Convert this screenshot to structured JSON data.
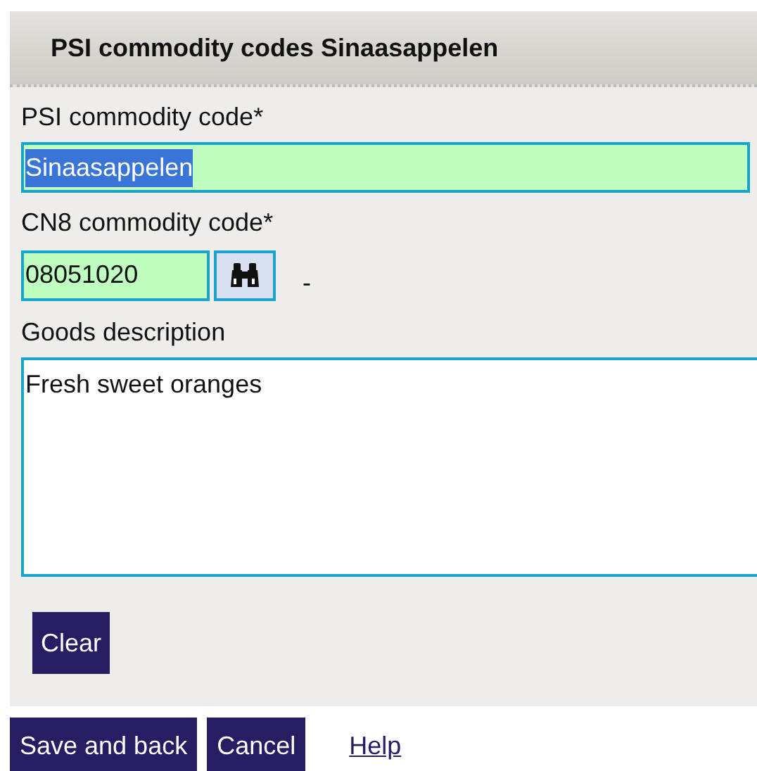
{
  "panel": {
    "title": "PSI commodity codes Sinaasappelen"
  },
  "fields": [
    {
      "kind": "text",
      "label": "PSI commodity code*",
      "value": "Sinaasappelen",
      "text_selected": true
    },
    {
      "kind": "lookup",
      "label": "CN8 commodity code*",
      "value": "08051020",
      "text_selected": false,
      "suffix": "-"
    },
    {
      "kind": "textarea",
      "label": "Goods description",
      "value": "Fresh sweet oranges",
      "text_selected": false
    }
  ],
  "panel_buttons": [
    "Clear"
  ],
  "footer": {
    "buttons": [
      "Save and back",
      "Cancel"
    ],
    "link": "Help"
  }
}
